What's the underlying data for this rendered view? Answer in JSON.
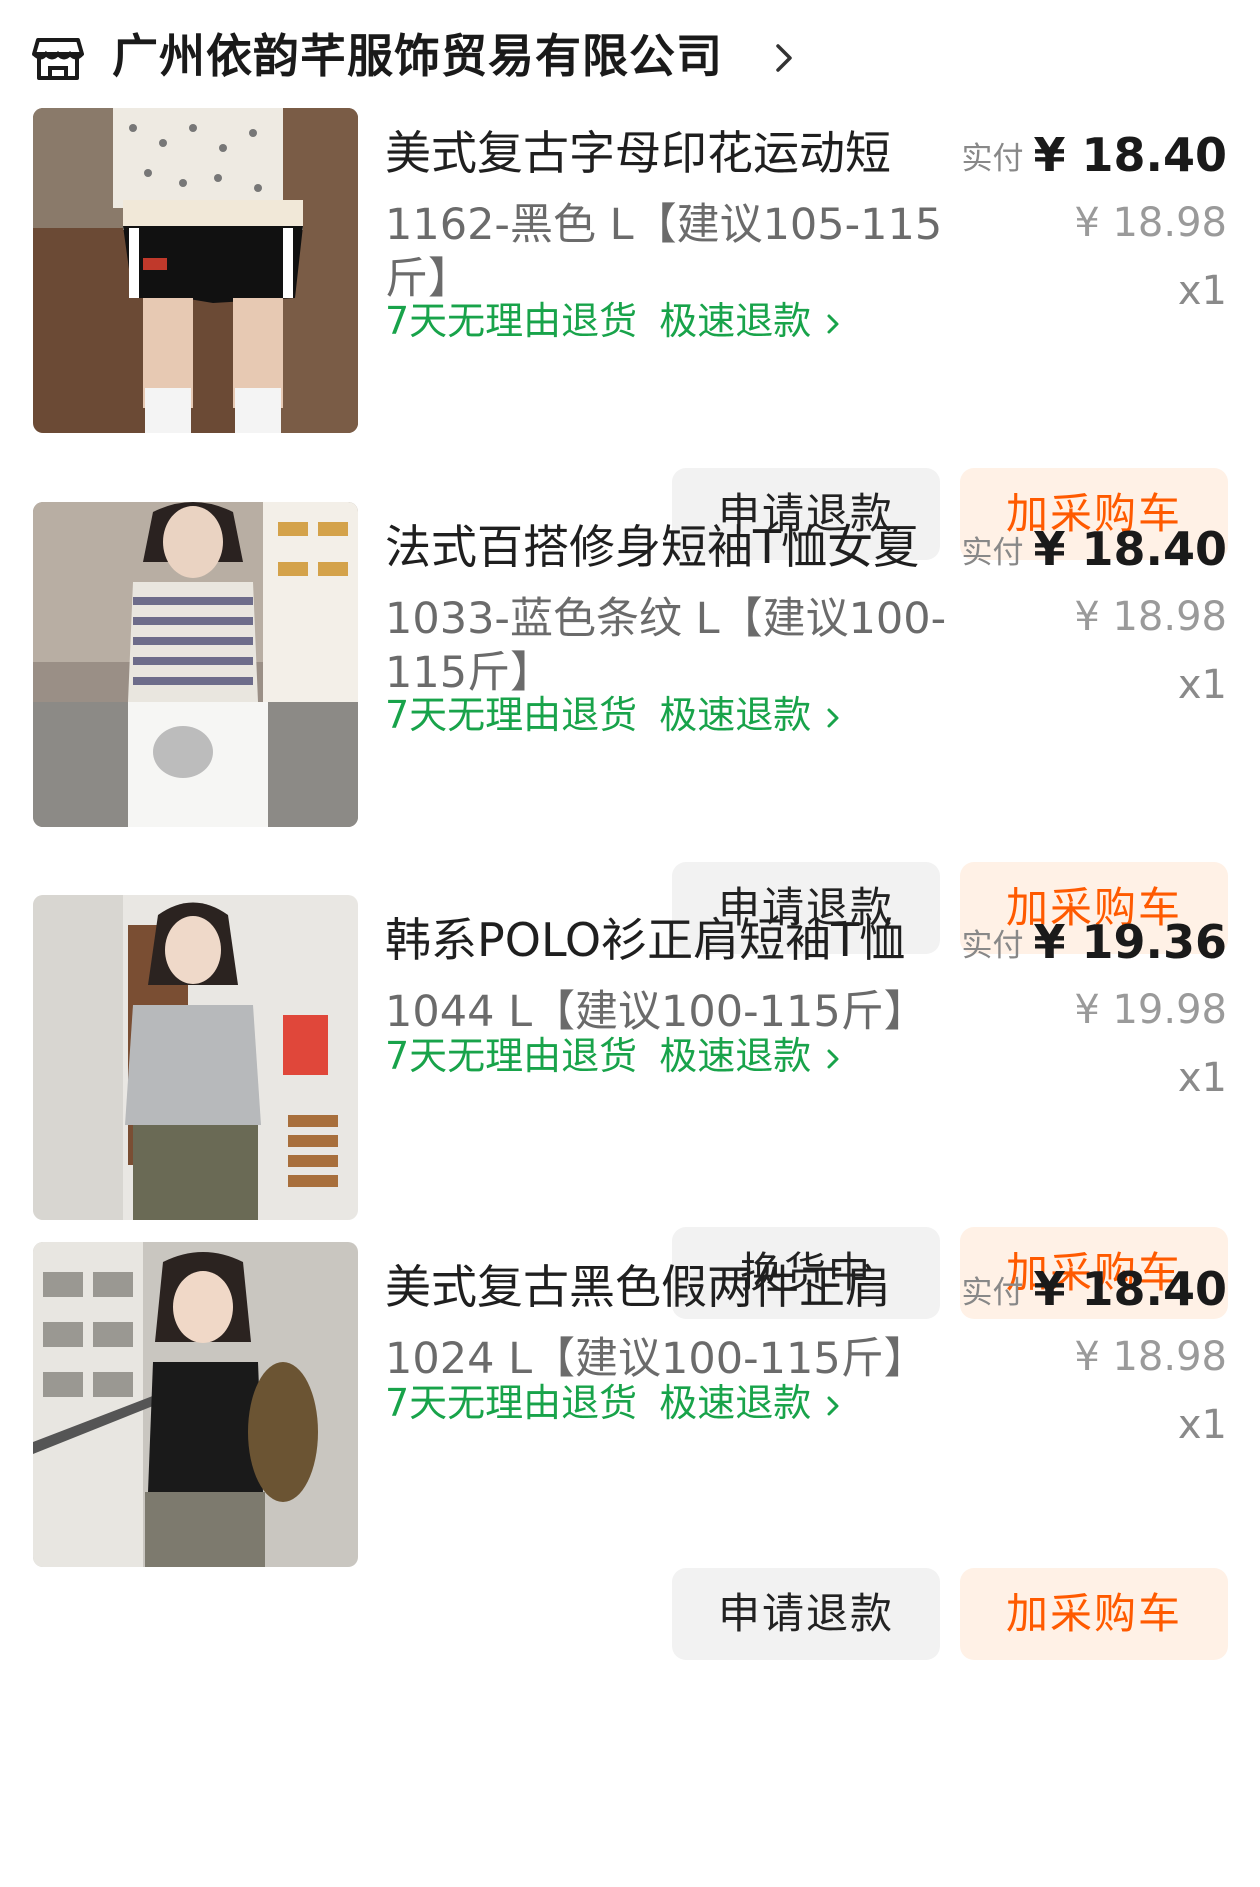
{
  "store": {
    "name": "广州依韵芊服饰贸易有限公司",
    "icon": "store-icon",
    "chevron_icon": "chevron-right-icon"
  },
  "colors": {
    "accent_orange": "#ff5a00",
    "cart_bg": "#fff1e6",
    "promo_green": "#18a34a",
    "gray_button_bg": "#f2f2f2"
  },
  "orders": [
    {
      "title": "美式复古字母印花运动短",
      "sku": "1162-黑色 L【建议105-115斤】",
      "promo_return": "7天无理由退货",
      "promo_refund": "极速退款",
      "paid_label": "实付",
      "paid_price": "¥ 18.40",
      "original_price": "¥ 18.98",
      "quantity": "x1",
      "action_label": "申请退款",
      "cart_label": "加采购车"
    },
    {
      "title": "法式百搭修身短袖T恤女夏",
      "sku": "1033-蓝色条纹 L【建议100-115斤】",
      "promo_return": "7天无理由退货",
      "promo_refund": "极速退款",
      "paid_label": "实付",
      "paid_price": "¥ 18.40",
      "original_price": "¥ 18.98",
      "quantity": "x1",
      "action_label": "申请退款",
      "cart_label": "加采购车"
    },
    {
      "title": "韩系POLO衫正肩短袖T恤",
      "sku": "1044 L【建议100-115斤】",
      "promo_return": "7天无理由退货",
      "promo_refund": "极速退款",
      "paid_label": "实付",
      "paid_price": "¥ 19.36",
      "original_price": "¥ 19.98",
      "quantity": "x1",
      "action_label": "换货中",
      "cart_label": "加采购车"
    },
    {
      "title": "美式复古黑色假两件正肩",
      "sku": "1024 L【建议100-115斤】",
      "promo_return": "7天无理由退货",
      "promo_refund": "极速退款",
      "paid_label": "实付",
      "paid_price": "¥ 18.40",
      "original_price": "¥ 18.98",
      "quantity": "x1",
      "action_label": "申请退款",
      "cart_label": "加采购车"
    }
  ]
}
